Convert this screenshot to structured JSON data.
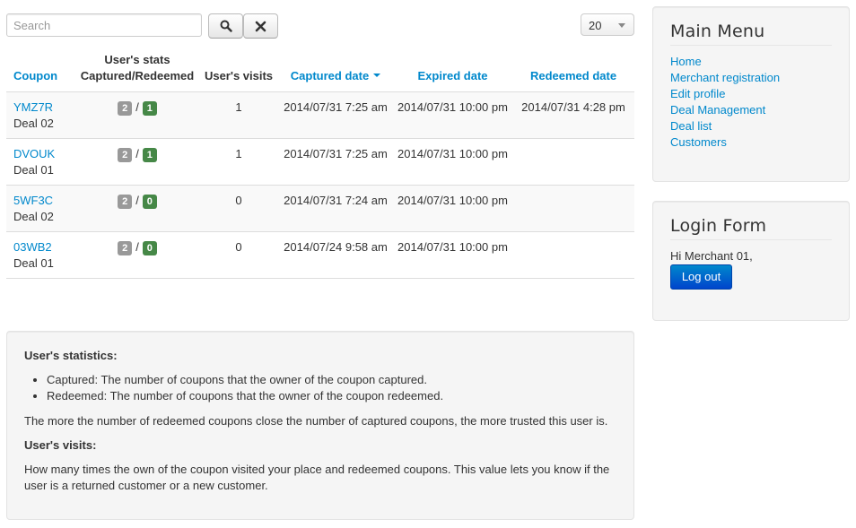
{
  "search": {
    "placeholder": "Search",
    "value": ""
  },
  "toolbar": {
    "search_icon": "search-icon",
    "clear_icon": "close-icon"
  },
  "list_limit": {
    "value": "20"
  },
  "table": {
    "headers": {
      "coupon": "Coupon",
      "stats_line1": "User's stats",
      "stats_line2": "Captured/Redeemed",
      "visits": "User's visits",
      "captured": "Captured date",
      "expired": "Expired date",
      "redeemed": "Redeemed date"
    },
    "rows": [
      {
        "code": "YMZ7R",
        "deal": "Deal 02",
        "captured_count": "2",
        "redeemed_count": "1",
        "visits": "1",
        "captured_date": "2014/07/31 7:25 am",
        "expired_date": "2014/07/31 10:00 pm",
        "redeemed_date": "2014/07/31 4:28 pm"
      },
      {
        "code": "DVOUK",
        "deal": "Deal 01",
        "captured_count": "2",
        "redeemed_count": "1",
        "visits": "1",
        "captured_date": "2014/07/31 7:25 am",
        "expired_date": "2014/07/31 10:00 pm",
        "redeemed_date": ""
      },
      {
        "code": "5WF3C",
        "deal": "Deal 02",
        "captured_count": "2",
        "redeemed_count": "0",
        "visits": "0",
        "captured_date": "2014/07/31 7:24 am",
        "expired_date": "2014/07/31 10:00 pm",
        "redeemed_date": ""
      },
      {
        "code": "03WB2",
        "deal": "Deal 01",
        "captured_count": "2",
        "redeemed_count": "0",
        "visits": "0",
        "captured_date": "2014/07/24 9:58 am",
        "expired_date": "2014/07/31 10:00 pm",
        "redeemed_date": ""
      }
    ],
    "separator": "/"
  },
  "info": {
    "stats_heading": "User's statistics:",
    "bullets": [
      "Captured: The number of coupons that the owner of the coupon captured.",
      "Redeemed: The number of coupons that the owner of the coupon redeemed."
    ],
    "stats_note": "The more the number of redeemed coupons close the number of captured coupons, the more trusted this user is.",
    "visits_heading": "User's visits:",
    "visits_note": "How many times the own of the coupon visited your place and redeemed coupons. This value lets you know if the user is a returned customer or a new customer."
  },
  "main_menu": {
    "title": "Main Menu",
    "items": [
      "Home",
      "Merchant registration",
      "Edit profile",
      "Deal Management",
      "Deal list",
      "Customers"
    ]
  },
  "login_form": {
    "title": "Login Form",
    "greeting": "Hi Merchant 01,",
    "logout_label": "Log out"
  },
  "colors": {
    "link": "#0088cc",
    "badge_gray": "#999999",
    "badge_green": "#468847",
    "button_primary": "#0055cc"
  }
}
